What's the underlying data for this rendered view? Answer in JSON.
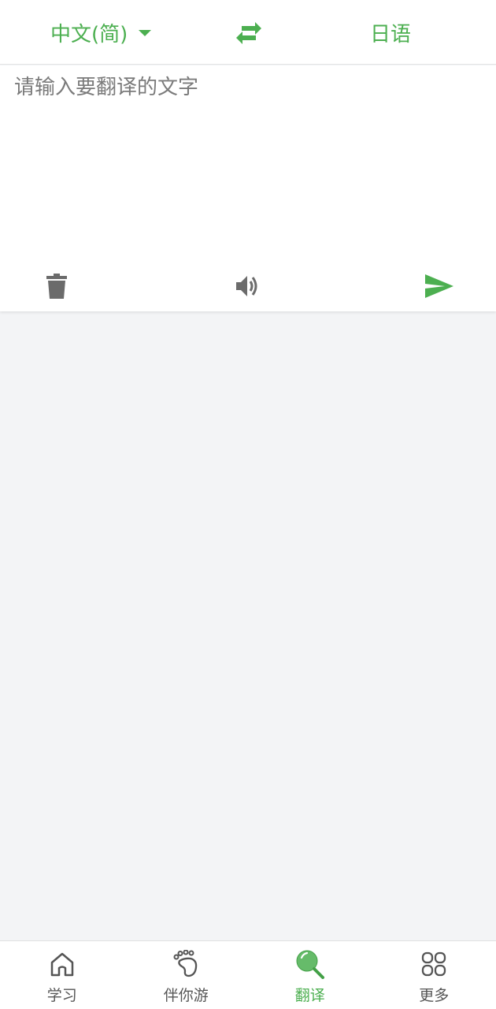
{
  "colors": {
    "accent": "#4caf50",
    "icon_gray": "#6b6b6b",
    "background": "#f3f4f6"
  },
  "language_bar": {
    "source_language": "中文(简)",
    "target_language": "日语",
    "swap_icon": "swap-arrows-icon",
    "dropdown_icon": "caret-down-icon"
  },
  "input": {
    "value": "",
    "placeholder": "请输入要翻译的文字"
  },
  "toolbar": {
    "delete_icon": "trash-icon",
    "speak_icon": "speaker-icon",
    "send_icon": "send-icon"
  },
  "tabs": [
    {
      "label": "学习",
      "icon": "home-icon",
      "active": false
    },
    {
      "label": "伴你游",
      "icon": "footprint-icon",
      "active": false
    },
    {
      "label": "翻译",
      "icon": "magnifier-icon",
      "active": true
    },
    {
      "label": "更多",
      "icon": "grid-icon",
      "active": false
    }
  ]
}
